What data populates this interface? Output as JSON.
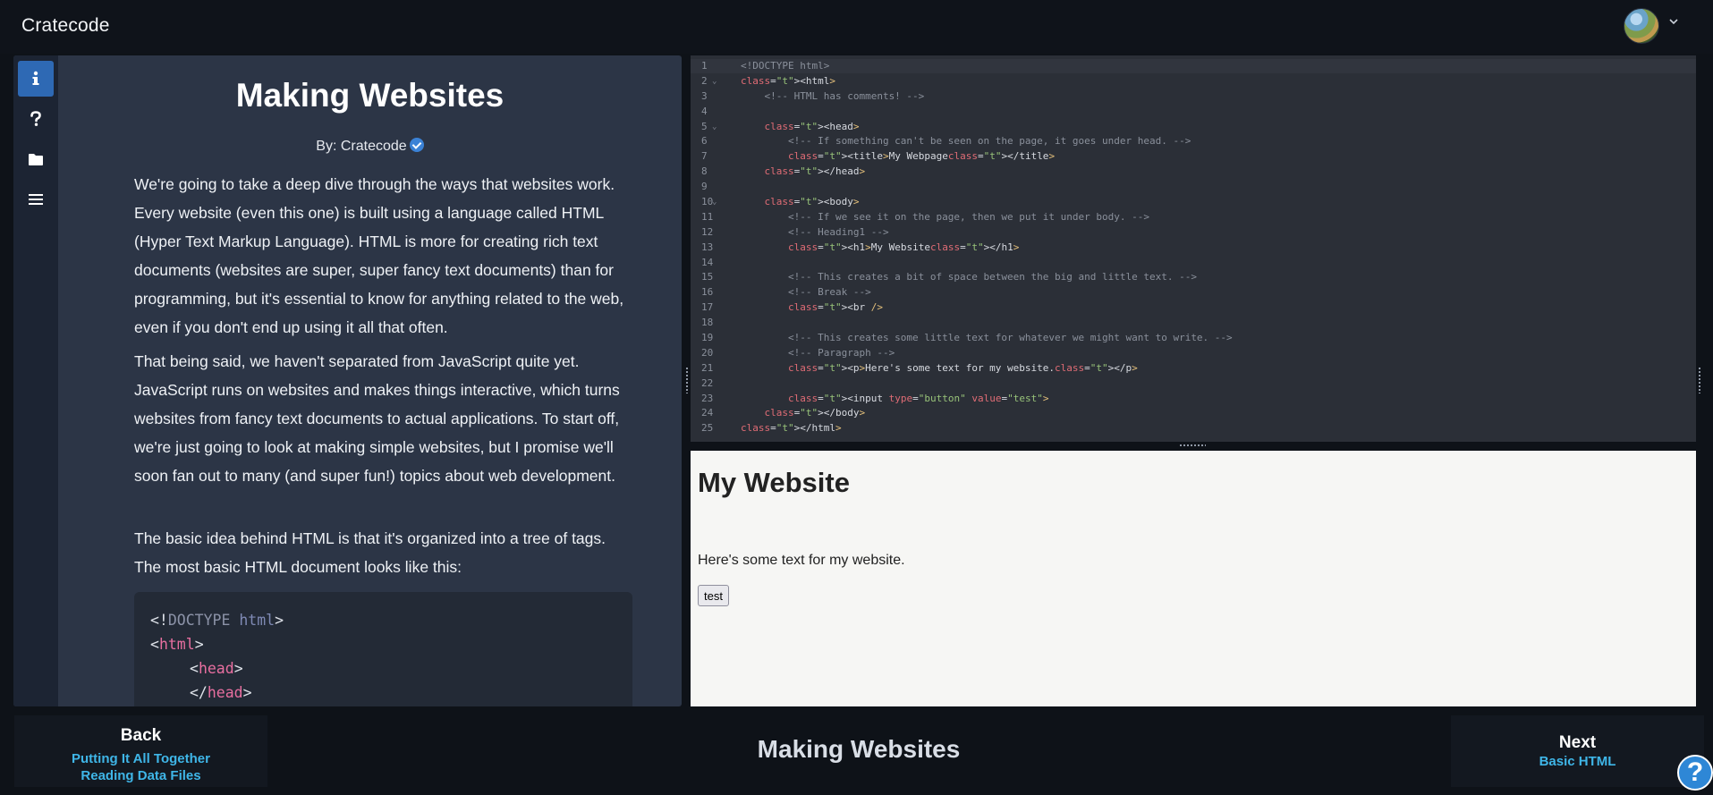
{
  "app": {
    "title": "Cratecode"
  },
  "lesson": {
    "title": "Making Websites",
    "author": "By: Cratecode",
    "paragraphs": [
      "We're going to take a deep dive through the ways that websites work. Every website (even this one) is built using a language called HTML (Hyper Text Markup Language). HTML is more for creating rich text documents (websites are super, super fancy text documents) than for programming, but it's essential to know for anything related to the web, even if you don't end up using it all that often.",
      "That being said, we haven't separated from JavaScript quite yet. JavaScript runs on websites and makes things interactive, which turns websites from fancy text documents to actual applications. To start off, we're just going to look at making simple websites, but I promise we'll soon fan out to many (and super fun!) topics about web development.",
      "The basic idea behind HTML is that it's organized into a tree of tags. The most basic HTML document looks like this:"
    ],
    "code_sample": {
      "line1_open": "<!",
      "line1_doctype": "DOCTYPE",
      "line1_html": " html",
      "line1_close": ">",
      "line2_lt": "<",
      "line2_tag": "html",
      "line2_gt": ">",
      "line3_lt": "<",
      "line3_tag": "head",
      "line3_gt": ">",
      "line4_lt": "</",
      "line4_tag": "head",
      "line4_gt": ""
    }
  },
  "sidebar": {
    "icons": [
      "info-icon",
      "question-icon",
      "folder-icon",
      "list-icon"
    ]
  },
  "editor": {
    "line_numbers": [
      "1",
      "2",
      "3",
      "4",
      "5",
      "6",
      "7",
      "8",
      "9",
      "10",
      "11",
      "12",
      "13",
      "14",
      "15",
      "16",
      "17",
      "18",
      "19",
      "20",
      "21",
      "22",
      "23",
      "24",
      "25"
    ],
    "lines": [
      "<!DOCTYPE html>",
      "<html>",
      "    <!-- HTML has comments! -->",
      "",
      "    <head>",
      "        <!-- If something can't be seen on the page, it goes under head. -->",
      "        <title>My Webpage</title>",
      "    </head>",
      "",
      "    <body>",
      "        <!-- If we see it on the page, then we put it under body. -->",
      "        <!-- Heading1 -->",
      "        <h1>My Website</h1>",
      "",
      "        <!-- This creates a bit of space between the big and little text. -->",
      "        <!-- Break -->",
      "        <br />",
      "",
      "        <!-- This creates some little text for whatever we might want to write. -->",
      "        <!-- Paragraph -->",
      "        <p>Here's some text for my website.</p>",
      "",
      "        <input type=\"button\" value=\"test\">",
      "    </body>",
      "</html>"
    ]
  },
  "preview": {
    "heading": "My Website",
    "paragraph": "Here's some text for my website.",
    "button": "test"
  },
  "nav": {
    "back_label": "Back",
    "back_links": [
      "Putting It All Together",
      "Reading Data Files"
    ],
    "current": "Making Websites",
    "next_label": "Next",
    "next_link": "Basic HTML"
  },
  "help": {
    "label": "?"
  }
}
